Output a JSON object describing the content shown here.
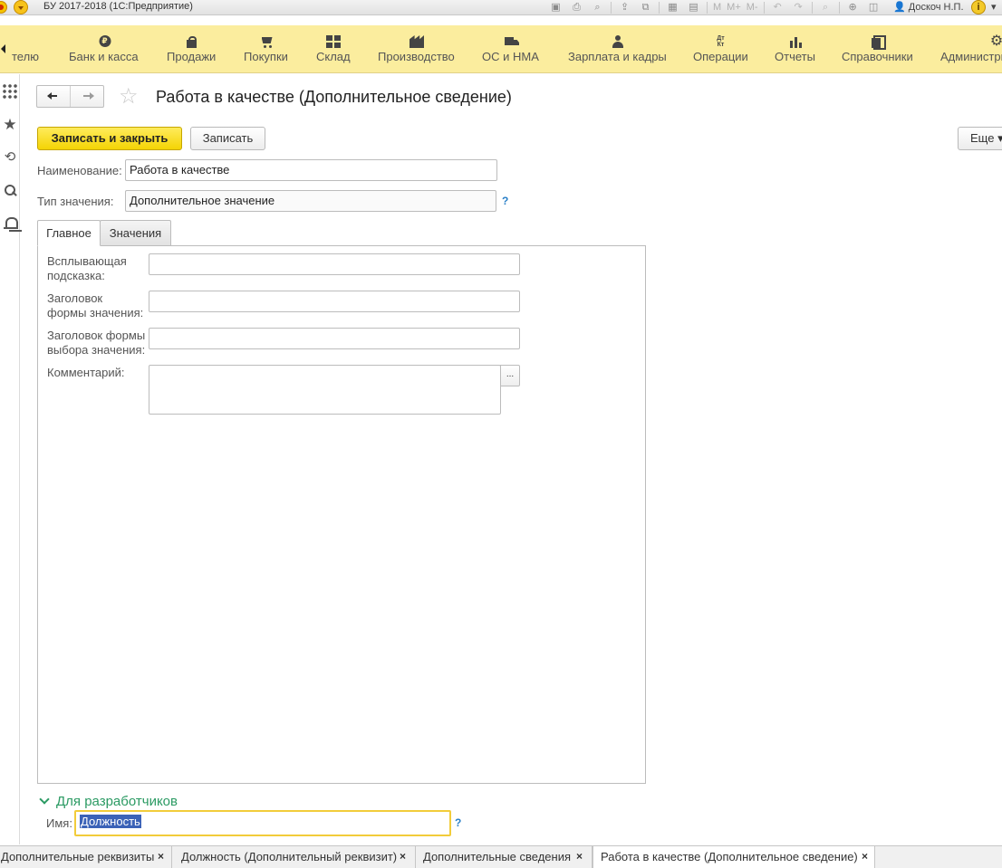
{
  "titlebar": {
    "title": "БУ 2017-2018  (1С:Предприятие)",
    "user": "Доскоч Н.П.",
    "tools": [
      "M",
      "M+",
      "M-"
    ]
  },
  "sections": [
    {
      "label": "телю",
      "icon": "partial"
    },
    {
      "label": "Банк и касса",
      "icon": "ruble-coin-icon"
    },
    {
      "label": "Продажи",
      "icon": "shopping-bag-icon"
    },
    {
      "label": "Покупки",
      "icon": "cart-icon"
    },
    {
      "label": "Склад",
      "icon": "stock-grid-icon"
    },
    {
      "label": "Производство",
      "icon": "factory-icon"
    },
    {
      "label": "ОС и НМА",
      "icon": "truck-icon"
    },
    {
      "label": "Зарплата и кадры",
      "icon": "person-icon"
    },
    {
      "label": "Операции",
      "icon": "dt-kt-icon"
    },
    {
      "label": "Отчеты",
      "icon": "bar-chart-icon"
    },
    {
      "label": "Справочники",
      "icon": "books-icon"
    },
    {
      "label": "Администри",
      "icon": "gear-icon"
    }
  ],
  "ruble_glyph": "₽",
  "dtkt": {
    "top": "Дт",
    "bottom": "Кт"
  },
  "form": {
    "title": "Работа в качестве (Дополнительное сведение)",
    "save_close": "Записать и закрыть",
    "save": "Записать",
    "more": "Еще",
    "more_caret": "▾",
    "name_label": "Наименование:",
    "name_value": "Работа в качестве",
    "type_label": "Тип значения:",
    "type_value": "Дополнительное значение",
    "help": "?"
  },
  "tabs": [
    {
      "label": "Главное",
      "active": true
    },
    {
      "label": "Значения",
      "active": false
    }
  ],
  "main_tab": {
    "tooltip_label": "Всплывающая\nподсказка:",
    "value_form_label": "Заголовок\nформы значения:",
    "select_form_label": "Заголовок формы\nвыбора значения:",
    "comment_label": "Комментарий:",
    "ellipsis": "..."
  },
  "developers": {
    "title": "Для разработчиков",
    "name_label": "Имя:",
    "name_value": "Должность"
  },
  "open_windows": [
    {
      "label": "Дополнительные реквизиты",
      "active": false
    },
    {
      "label": "Должность (Дополнительный реквизит)",
      "active": false
    },
    {
      "label": "Дополнительные сведения",
      "active": false
    },
    {
      "label": "Работа в качестве (Дополнительное сведение)",
      "active": true
    }
  ],
  "close_glyph": "×"
}
